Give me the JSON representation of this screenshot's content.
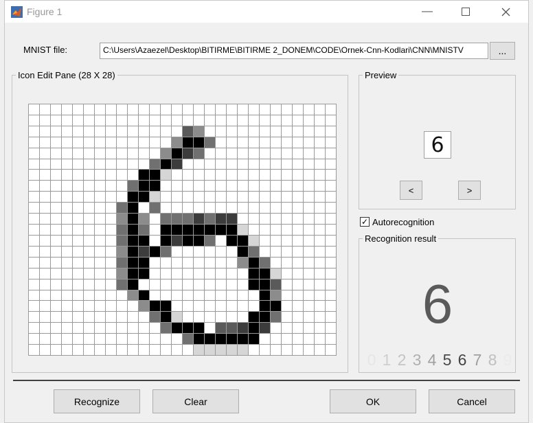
{
  "window": {
    "title": "Figure 1"
  },
  "mnist": {
    "label": "MNIST file:",
    "path": "C:\\Users\\Azaezel\\Desktop\\BITIRME\\BITIRME 2_DONEM\\CODE\\Ornek-Cnn-Kodlari\\CNN\\MNISTV",
    "browse_label": "..."
  },
  "edit_pane": {
    "title": "Icon Edit Pane (28 X 28)",
    "visible_rows": 23,
    "cols": 28,
    "pixels": [
      "............................",
      "............................",
      "..............D3............",
      ".............3BB2...........",
      "............3B12............",
      "...........2B1..............",
      "..........BBL...............",
      ".........2BB................",
      ".........BBL................",
      "........2B.2................",
      "........3B3.2221211.........",
      "........2B2.BBBBBBBL........",
      "........2BB.B1BB2.BBL.......",
      "........3B1B2......B2.......",
      "........2BB........3B2......",
      "........3BB.........BBL.....",
      "........2B..........BBD.....",
      ".........3B..........B3.....",
      "..........3BB........BB.....",
      "...........2BL......BB2.....",
      "............2BBB.DD1B1......",
      "..............2BBBBBB.......",
      "...............LLLLL........"
    ]
  },
  "preview": {
    "title": "Preview",
    "glyph": "6",
    "prev_label": "<",
    "next_label": ">"
  },
  "autorecognition": {
    "label": "Autorecognition",
    "checked": true
  },
  "result": {
    "title": "Recognition result",
    "digit": "6",
    "scores": [
      {
        "d": "0",
        "c": "#e6e6e6"
      },
      {
        "d": "1",
        "c": "#cfcfcf"
      },
      {
        "d": "2",
        "c": "#c4c4c4"
      },
      {
        "d": "3",
        "c": "#b0b0b0"
      },
      {
        "d": "4",
        "c": "#a0a0a0"
      },
      {
        "d": "5",
        "c": "#4a4a4a"
      },
      {
        "d": "6",
        "c": "#444444"
      },
      {
        "d": "7",
        "c": "#a0a0a0"
      },
      {
        "d": "8",
        "c": "#c0c0c0"
      },
      {
        "d": "9",
        "c": "#ebebeb"
      }
    ]
  },
  "buttons": {
    "recognize": "Recognize",
    "clear": "Clear",
    "ok": "OK",
    "cancel": "Cancel"
  },
  "colors": {
    "B": "#000000",
    "1": "#3c3c3c",
    "2": "#707070",
    "3": "#8c8c8c",
    "D": "#5a5a5a",
    "L": "#d6d6d6",
    ".": "#ffffff"
  }
}
